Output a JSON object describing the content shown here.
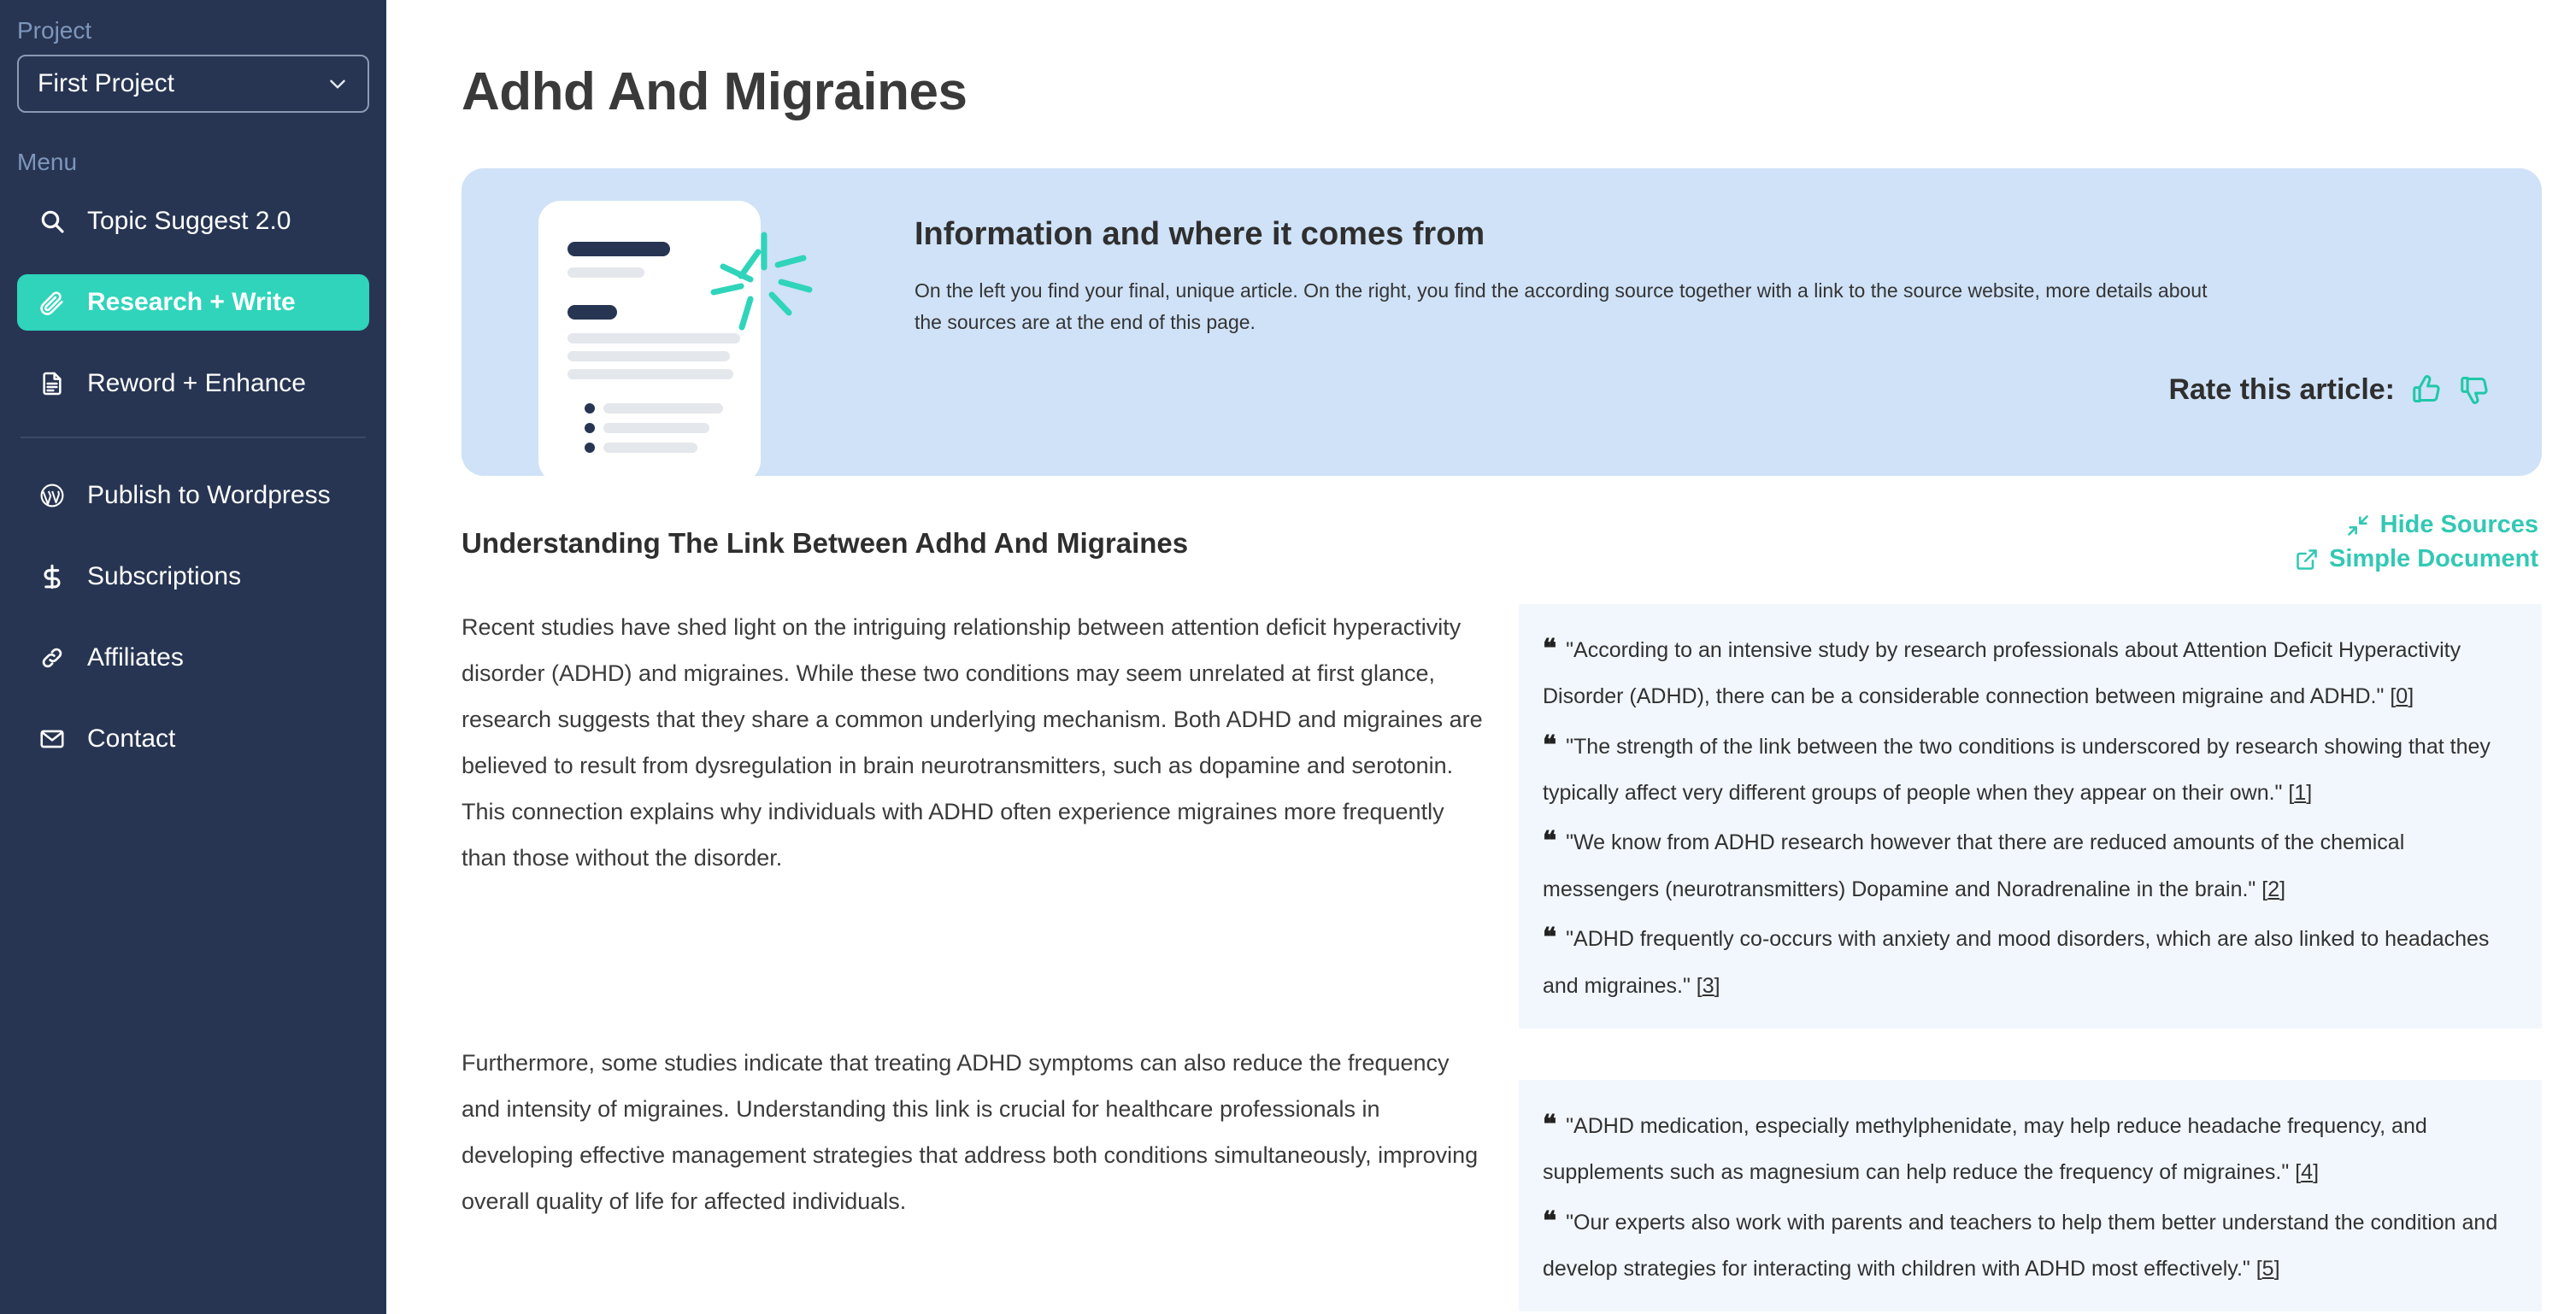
{
  "sidebar": {
    "project_label": "Project",
    "project_value": "First Project",
    "menu_label": "Menu",
    "items": [
      {
        "label": "Topic Suggest 2.0",
        "icon": "search-icon",
        "active": false
      },
      {
        "label": "Research + Write",
        "icon": "paperclip-icon",
        "active": true
      },
      {
        "label": "Reword + Enhance",
        "icon": "document-icon",
        "active": false
      }
    ],
    "items2": [
      {
        "label": "Publish to Wordpress",
        "icon": "wordpress-icon"
      },
      {
        "label": "Subscriptions",
        "icon": "dollar-icon"
      },
      {
        "label": "Affiliates",
        "icon": "link-icon"
      },
      {
        "label": "Contact",
        "icon": "envelope-icon"
      }
    ]
  },
  "main": {
    "page_title": "Adhd And Migraines",
    "banner": {
      "title": "Information and where it comes from",
      "description": "On the left you find your final, unique article. On the right, you find the according source together with a link to the source website, more details about the sources are at the end of this page.",
      "rate_label": "Rate this article:",
      "thumb_up_icon": "thumbs-up-icon",
      "thumb_down_icon": "thumbs-down-icon"
    },
    "toggles": {
      "hide_sources": "Hide Sources",
      "hide_sources_icon": "collapse-arrows-icon",
      "simple_document": "Simple Document",
      "simple_document_icon": "external-link-icon"
    },
    "section_heading": "Understanding The Link Between Adhd And Migraines",
    "paragraphs": [
      "Recent studies have shed light on the intriguing relationship between attention deficit hyperactivity disorder (ADHD) and migraines. While these two conditions may seem unrelated at first glance, research suggests that they share a common underlying mechanism. Both ADHD and migraines are believed to result from dysregulation in brain neurotransmitters, such as dopamine and serotonin. This connection explains why individuals with ADHD often experience migraines more frequently than those without the disorder.",
      "Furthermore, some studies indicate that treating ADHD symptoms can also reduce the frequency and intensity of migraines. Understanding this link is crucial for healthcare professionals in developing effective management strategies that address both conditions simultaneously, improving overall quality of life for affected individuals."
    ],
    "source_blocks": [
      {
        "quotes": [
          {
            "text": "\"According to an intensive study by research professionals about Attention Deficit Hyperactivity Disorder (ADHD), there can be a considerable connection between migraine and ADHD.\"",
            "ref": "0"
          },
          {
            "text": "\"The strength of the link between the two conditions is underscored by research showing that they typically affect very different groups of people when they appear on their own.\"",
            "ref": "1"
          },
          {
            "text": "\"We know from ADHD research however that there are reduced amounts of the chemical messengers (neurotransmitters) Dopamine and Noradrenaline in the brain.\"",
            "ref": "2"
          },
          {
            "text": "\"ADHD frequently co-occurs with anxiety and mood disorders, which are also linked to headaches and migraines.\"",
            "ref": "3"
          }
        ]
      },
      {
        "quotes": [
          {
            "text": "\"ADHD medication, especially methylphenidate, may help reduce headache frequency, and supplements such as magnesium can help reduce the frequency of migraines.\"",
            "ref": "4"
          },
          {
            "text": "\"Our experts also work with parents and teachers to help them better understand the condition and develop strategies for interacting with children with ADHD most effectively.\"",
            "ref": "5"
          }
        ]
      }
    ]
  },
  "colors": {
    "sidebar_bg": "#273553",
    "accent_teal": "#2fd4bb",
    "banner_blue": "#cfe2f7",
    "source_bg": "#f2f7fd",
    "muted_label": "#7f96bb"
  }
}
